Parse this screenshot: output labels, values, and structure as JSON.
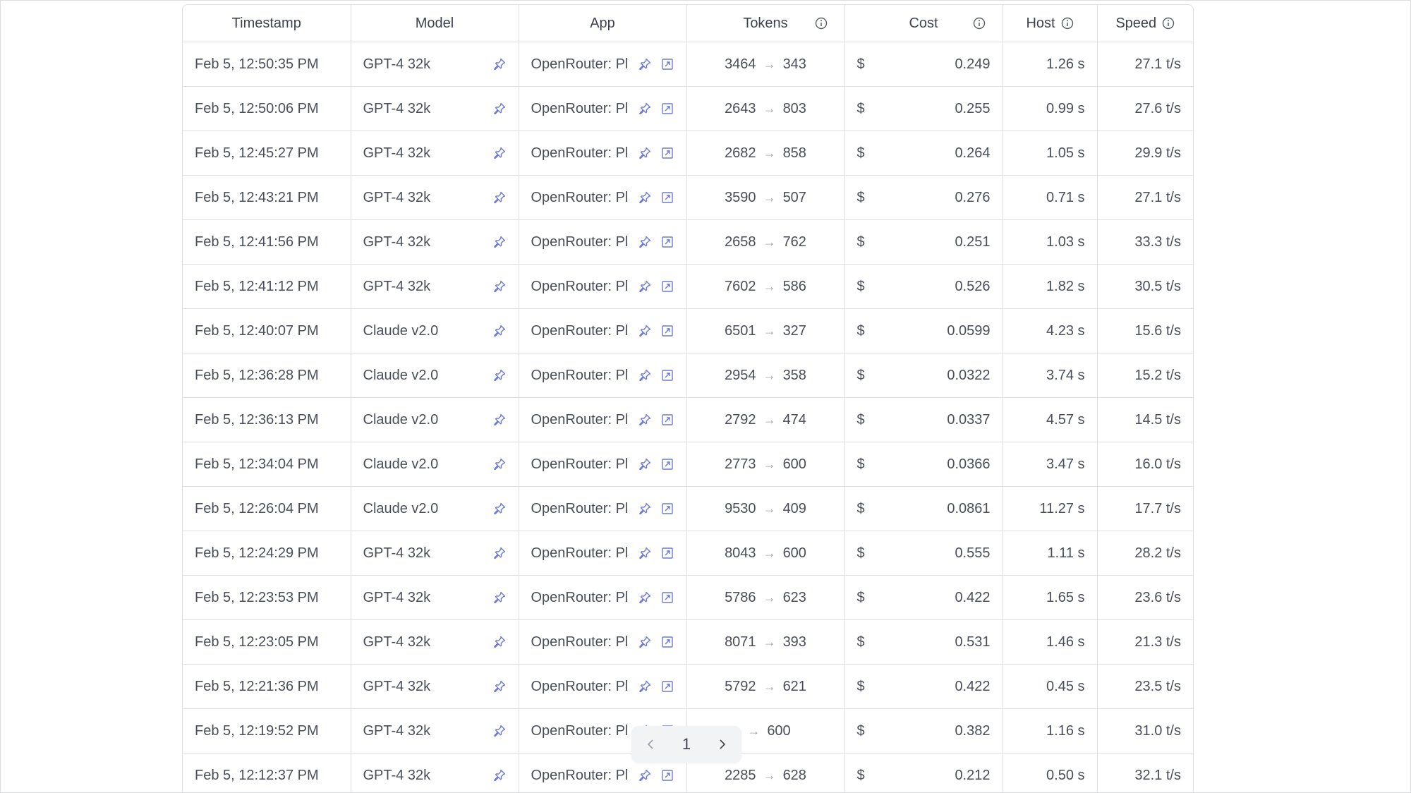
{
  "headers": {
    "timestamp": "Timestamp",
    "model": "Model",
    "app": "App",
    "tokens": "Tokens",
    "cost": "Cost",
    "host": "Host",
    "speed": "Speed"
  },
  "rows": [
    {
      "timestamp": "Feb 5, 12:50:35 PM",
      "model": "GPT-4 32k",
      "app": "OpenRouter: Pl",
      "tokens_in": "3464",
      "tokens_out": "343",
      "currency": "$",
      "cost": "0.249",
      "host": "1.26 s",
      "speed": "27.1 t/s"
    },
    {
      "timestamp": "Feb 5, 12:50:06 PM",
      "model": "GPT-4 32k",
      "app": "OpenRouter: Pl",
      "tokens_in": "2643",
      "tokens_out": "803",
      "currency": "$",
      "cost": "0.255",
      "host": "0.99 s",
      "speed": "27.6 t/s"
    },
    {
      "timestamp": "Feb 5, 12:45:27 PM",
      "model": "GPT-4 32k",
      "app": "OpenRouter: Pl",
      "tokens_in": "2682",
      "tokens_out": "858",
      "currency": "$",
      "cost": "0.264",
      "host": "1.05 s",
      "speed": "29.9 t/s"
    },
    {
      "timestamp": "Feb 5, 12:43:21 PM",
      "model": "GPT-4 32k",
      "app": "OpenRouter: Pl",
      "tokens_in": "3590",
      "tokens_out": "507",
      "currency": "$",
      "cost": "0.276",
      "host": "0.71 s",
      "speed": "27.1 t/s"
    },
    {
      "timestamp": "Feb 5, 12:41:56 PM",
      "model": "GPT-4 32k",
      "app": "OpenRouter: Pl",
      "tokens_in": "2658",
      "tokens_out": "762",
      "currency": "$",
      "cost": "0.251",
      "host": "1.03 s",
      "speed": "33.3 t/s"
    },
    {
      "timestamp": "Feb 5, 12:41:12 PM",
      "model": "GPT-4 32k",
      "app": "OpenRouter: Pl",
      "tokens_in": "7602",
      "tokens_out": "586",
      "currency": "$",
      "cost": "0.526",
      "host": "1.82 s",
      "speed": "30.5 t/s"
    },
    {
      "timestamp": "Feb 5, 12:40:07 PM",
      "model": "Claude v2.0",
      "app": "OpenRouter: Pl",
      "tokens_in": "6501",
      "tokens_out": "327",
      "currency": "$",
      "cost": "0.0599",
      "host": "4.23 s",
      "speed": "15.6 t/s"
    },
    {
      "timestamp": "Feb 5, 12:36:28 PM",
      "model": "Claude v2.0",
      "app": "OpenRouter: Pl",
      "tokens_in": "2954",
      "tokens_out": "358",
      "currency": "$",
      "cost": "0.0322",
      "host": "3.74 s",
      "speed": "15.2 t/s"
    },
    {
      "timestamp": "Feb 5, 12:36:13 PM",
      "model": "Claude v2.0",
      "app": "OpenRouter: Pl",
      "tokens_in": "2792",
      "tokens_out": "474",
      "currency": "$",
      "cost": "0.0337",
      "host": "4.57 s",
      "speed": "14.5 t/s"
    },
    {
      "timestamp": "Feb 5, 12:34:04 PM",
      "model": "Claude v2.0",
      "app": "OpenRouter: Pl",
      "tokens_in": "2773",
      "tokens_out": "600",
      "currency": "$",
      "cost": "0.0366",
      "host": "3.47 s",
      "speed": "16.0 t/s"
    },
    {
      "timestamp": "Feb 5, 12:26:04 PM",
      "model": "Claude v2.0",
      "app": "OpenRouter: Pl",
      "tokens_in": "9530",
      "tokens_out": "409",
      "currency": "$",
      "cost": "0.0861",
      "host": "11.27 s",
      "speed": "17.7 t/s"
    },
    {
      "timestamp": "Feb 5, 12:24:29 PM",
      "model": "GPT-4 32k",
      "app": "OpenRouter: Pl",
      "tokens_in": "8043",
      "tokens_out": "600",
      "currency": "$",
      "cost": "0.555",
      "host": "1.11 s",
      "speed": "28.2 t/s"
    },
    {
      "timestamp": "Feb 5, 12:23:53 PM",
      "model": "GPT-4 32k",
      "app": "OpenRouter: Pl",
      "tokens_in": "5786",
      "tokens_out": "623",
      "currency": "$",
      "cost": "0.422",
      "host": "1.65 s",
      "speed": "23.6 t/s"
    },
    {
      "timestamp": "Feb 5, 12:23:05 PM",
      "model": "GPT-4 32k",
      "app": "OpenRouter: Pl",
      "tokens_in": "8071",
      "tokens_out": "393",
      "currency": "$",
      "cost": "0.531",
      "host": "1.46 s",
      "speed": "21.3 t/s"
    },
    {
      "timestamp": "Feb 5, 12:21:36 PM",
      "model": "GPT-4 32k",
      "app": "OpenRouter: Pl",
      "tokens_in": "5792",
      "tokens_out": "621",
      "currency": "$",
      "cost": "0.422",
      "host": "0.45 s",
      "speed": "23.5 t/s"
    },
    {
      "timestamp": "Feb 5, 12:19:52 PM",
      "model": "GPT-4 32k",
      "app": "OpenRouter: Pl",
      "tokens_in": "",
      "tokens_out": "600",
      "currency": "$",
      "cost": "0.382",
      "host": "1.16 s",
      "speed": "31.0 t/s"
    },
    {
      "timestamp": "Feb 5, 12:12:37 PM",
      "model": "GPT-4 32k",
      "app": "OpenRouter: Pl",
      "tokens_in": "2285",
      "tokens_out": "628",
      "currency": "$",
      "cost": "0.212",
      "host": "0.50 s",
      "speed": "32.1 t/s"
    }
  ],
  "pagination": {
    "current_page": "1"
  },
  "icons": {
    "pin": "pin-icon",
    "open": "open-external-icon",
    "info": "info-icon",
    "prev": "chevron-left-icon",
    "next": "chevron-right-icon"
  },
  "colors": {
    "accent": "#6c7bd9",
    "border": "#dedfe3",
    "text": "#4a4e5a"
  }
}
